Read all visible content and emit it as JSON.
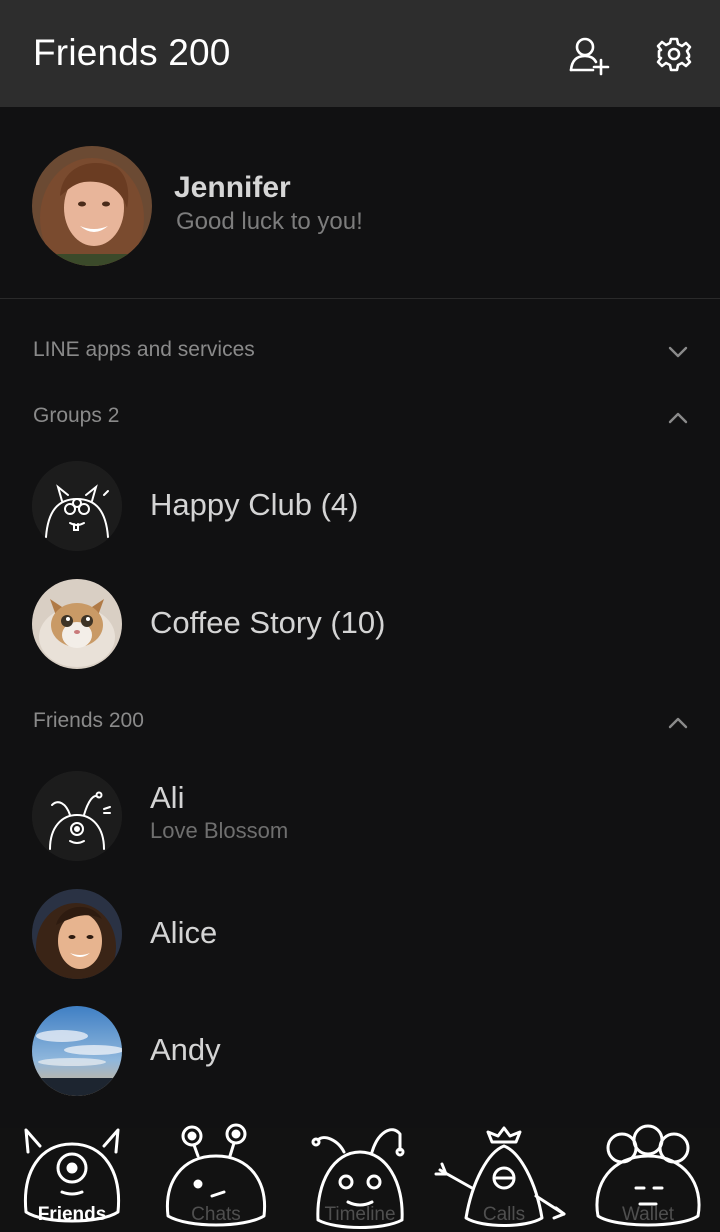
{
  "header": {
    "title": "Friends 200",
    "add_friend_icon": "add-user-icon",
    "settings_icon": "gear-icon"
  },
  "profile": {
    "name": "Jennifer",
    "status": "Good luck to you!"
  },
  "sections": {
    "apps": {
      "label": "LINE apps and services",
      "expanded": false
    },
    "groups": {
      "label": "Groups 2",
      "expanded": true
    },
    "friends": {
      "label": "Friends 200",
      "expanded": true
    }
  },
  "groups": [
    {
      "name": "Happy Club (4)"
    },
    {
      "name": "Coffee Story (10)"
    }
  ],
  "friends": [
    {
      "name": "Ali",
      "status": "Love Blossom"
    },
    {
      "name": "Alice"
    },
    {
      "name": "Andy"
    }
  ],
  "tabs": [
    {
      "label": "Friends",
      "active": true
    },
    {
      "label": "Chats",
      "active": false
    },
    {
      "label": "Timeline",
      "active": false
    },
    {
      "label": "Calls",
      "active": false
    },
    {
      "label": "Wallet",
      "active": false
    }
  ],
  "colors": {
    "background": "#111112",
    "header": "#2d2d2d",
    "text_primary": "#d4d4d4",
    "text_secondary": "#7d7d7d"
  }
}
